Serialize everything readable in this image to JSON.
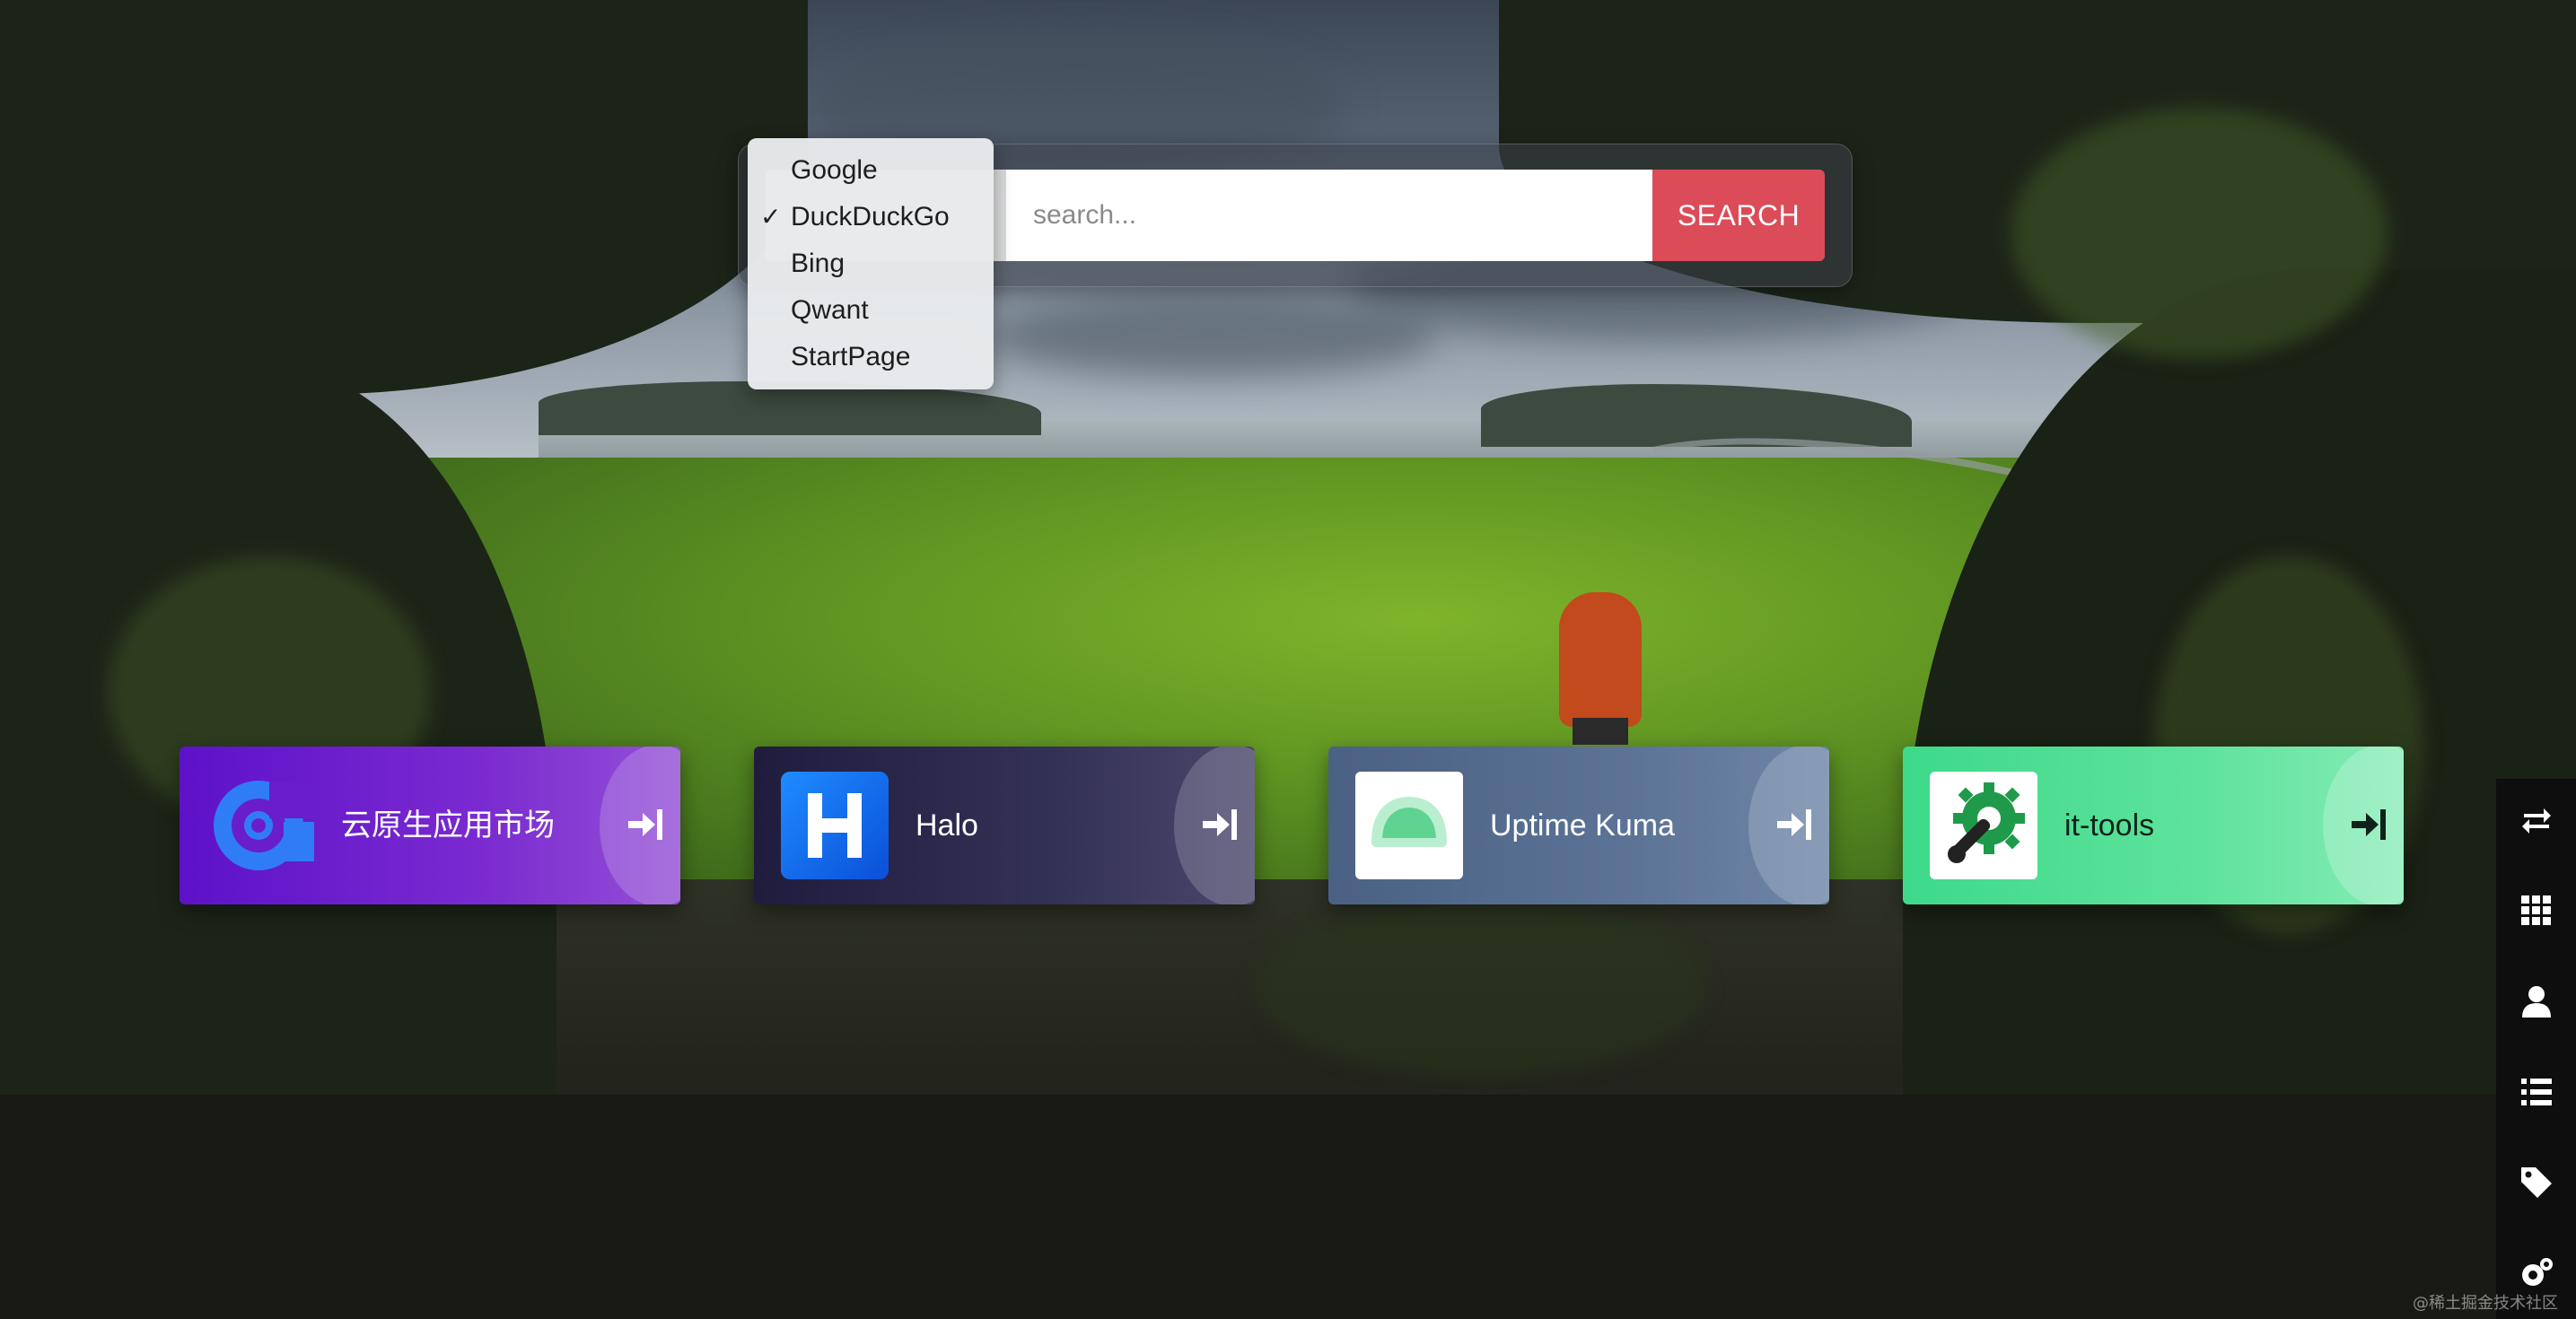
{
  "search": {
    "placeholder": "search...",
    "button_label": "SEARCH",
    "selected_engine": "DuckDuckGo",
    "engines": [
      "Google",
      "DuckDuckGo",
      "Bing",
      "Qwant",
      "StartPage"
    ],
    "button_color": "#dc4b58"
  },
  "apps": [
    {
      "label": "云原生应用市场",
      "icon": "cloud-market-logo-icon",
      "color": "#6a1dcc"
    },
    {
      "label": "Halo",
      "icon": "halo-logo-icon",
      "color": "#2a2749"
    },
    {
      "label": "Uptime Kuma",
      "icon": "uptime-kuma-logo-icon",
      "color": "#56709a"
    },
    {
      "label": "it-tools",
      "icon": "it-tools-logo-icon",
      "color": "#4ddf93"
    }
  ],
  "toolbar": {
    "items": [
      "swap-icon",
      "grid-icon",
      "user-icon",
      "list-icon",
      "tag-icon",
      "settings-icon"
    ]
  },
  "watermark": "@稀土掘金技术社区"
}
